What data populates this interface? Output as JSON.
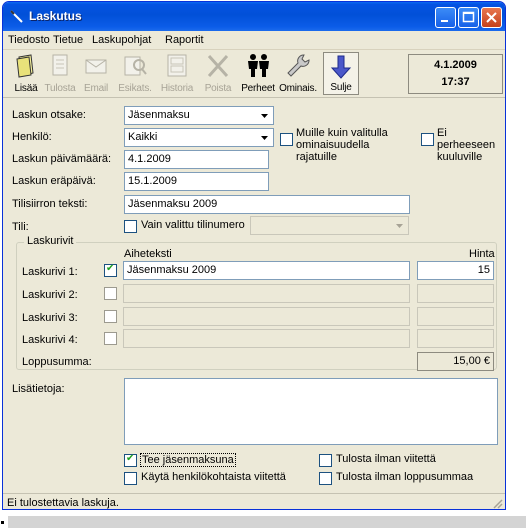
{
  "window": {
    "title": "Laskutus"
  },
  "menu": [
    "Tiedosto",
    "Tietue",
    "Laskupohjat",
    "Raportit"
  ],
  "toolbar": {
    "add": "Lisää",
    "print": "Tulosta",
    "email": "Email",
    "preview": "Esikats.",
    "history": "Historia",
    "delete": "Poista",
    "families": "Perheet",
    "properties": "Ominais.",
    "close": "Sulje"
  },
  "datebox": {
    "date": "4.1.2009",
    "time": "17:37"
  },
  "form": {
    "header_label": "Laskun otsake:",
    "header_value": "Jäsenmaksu",
    "person_label": "Henkilö:",
    "person_value": "Kaikki",
    "others_label": "Muille kuin valitulla ominaisuudella rajatuille",
    "nonfamily_label": "Ei perheeseen kuuluville",
    "invoice_date_label": "Laskun päivämäärä:",
    "invoice_date_value": "4.1.2009",
    "due_date_label": "Laskun eräpäivä:",
    "due_date_value": "15.1.2009",
    "transfer_label": "Tilisiirron teksti:",
    "transfer_value": "Jäsenmaksu 2009",
    "account_label": "Tili:",
    "only_account_label": "Vain valittu tilinumero"
  },
  "lines": {
    "group_title": "Laskurivit",
    "subject_header": "Aiheteksti",
    "price_header": "Hinta",
    "rows": [
      {
        "label": "Laskurivi 1:",
        "checked": true,
        "subject": "Jäsenmaksu 2009",
        "price": "15"
      },
      {
        "label": "Laskurivi 2:",
        "checked": false,
        "subject": "",
        "price": ""
      },
      {
        "label": "Laskurivi 3:",
        "checked": false,
        "subject": "",
        "price": ""
      },
      {
        "label": "Laskurivi 4:",
        "checked": false,
        "subject": "",
        "price": ""
      }
    ],
    "total_label": "Loppusumma:",
    "total_value": "15,00 €"
  },
  "extra": {
    "info_label": "Lisätietoja:",
    "membership_fee": "Tee jäsenmaksuna",
    "personal_reference": "Käytä henkilökohtaista viitettä",
    "print_no_reference": "Tulosta ilman viitettä",
    "print_no_total": "Tulosta ilman loppusummaa"
  },
  "status": "Ei tulostettavia laskuja.",
  "colors": {
    "titlebar": "#0250d8",
    "face": "#ece9d8",
    "input_border": "#7f9db9"
  }
}
